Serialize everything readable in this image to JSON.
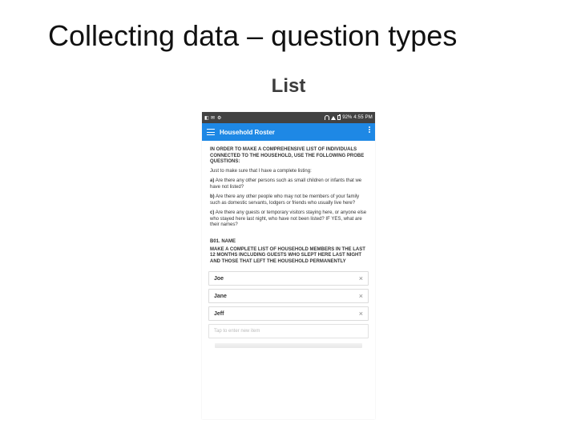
{
  "slide": {
    "title": "Collecting data – question types",
    "subtitle": "List"
  },
  "statusbar": {
    "clock": "4:55 PM",
    "battery_pct": "92%"
  },
  "appbar": {
    "title": "Household Roster"
  },
  "instructions": {
    "intro": "IN ORDER TO MAKE A COMPREHENSIVE LIST OF INDIVIDUALS CONNECTED TO THE HOUSEHOLD, USE THE FOLLOWING PROBE QUESTIONS:",
    "lead": "Just to make sure that I have a complete listing:",
    "a_label": "a)",
    "a_text": "Are there any other persons such as small children or infants that we have not listed?",
    "b_label": "b)",
    "b_text": "Are there any other people who may not be members of your family such as domestic servants, lodgers or friends who usually live here?",
    "c_label": "c)",
    "c_text": "Are there any guests or temporary visitors staying here, or anyone else who stayed here last night, who have not been listed? IF YES, what are their names?"
  },
  "question": {
    "number": "B01. NAME",
    "text": "MAKE A COMPLETE LIST OF HOUSEHOLD MEMBERS IN THE LAST 12 MONTHS INCLUDING GUESTS WHO SLEPT HERE LAST NIGHT AND THOSE THAT LEFT THE HOUSEHOLD PERMANENTLY"
  },
  "list": {
    "items": [
      {
        "name": "Joe"
      },
      {
        "name": "Jane"
      },
      {
        "name": "Jeff"
      }
    ],
    "placeholder": "Tap to enter new item"
  },
  "icons": {
    "close_glyph": "×"
  }
}
